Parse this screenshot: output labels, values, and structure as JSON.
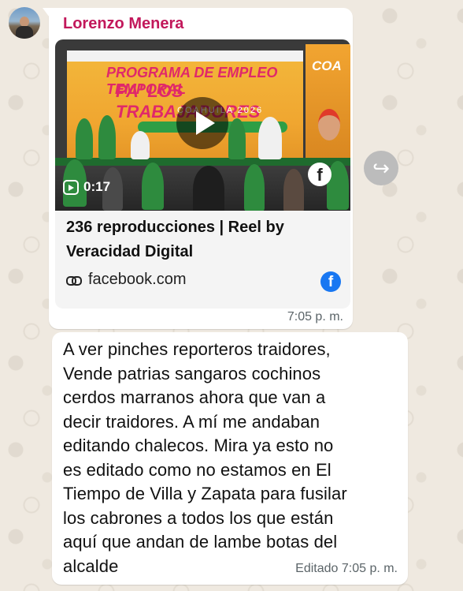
{
  "sender": {
    "name": "Lorenzo Menera"
  },
  "link_preview": {
    "video": {
      "banner_line1": "PROGRAMA DE EMPLEO TEMPORAL",
      "banner_line2": "PA' LOS TRABAJADORES",
      "banner_line3": "COAHUILA 2026",
      "side_logo": "COA",
      "duration": "0:17",
      "play_icon": "play-icon",
      "reel_icon": "reels-icon",
      "fb_icon": "f"
    },
    "description_line1": "236 reproducciones | Reel by",
    "description_line2": "Veracidad Digital",
    "source": "facebook.com",
    "source_icon": "link-icon",
    "platform_icon": "f"
  },
  "message1_time": "7:05 p. m.",
  "forward_icon": "↪",
  "message2": {
    "lines": [
      "A ver pinches reporteros traidores,",
      "Vende patrias sangaros cochinos",
      "cerdos marranos ahora que van a",
      "decir traidores. A mí me andaban",
      "editando chalecos. Mira ya esto no",
      "es editado como no estamos en El",
      "Tiempo de Villa y Zapata para fusilar",
      "los cabrones a todos los que están",
      "aquí que andan de lambe botas del",
      "alcalde"
    ],
    "time": "Editado 7:05 p. m."
  },
  "colors": {
    "sender": "#c2185b",
    "facebook": "#1877f2",
    "bubble": "#ffffff",
    "background": "#efe9e0"
  }
}
